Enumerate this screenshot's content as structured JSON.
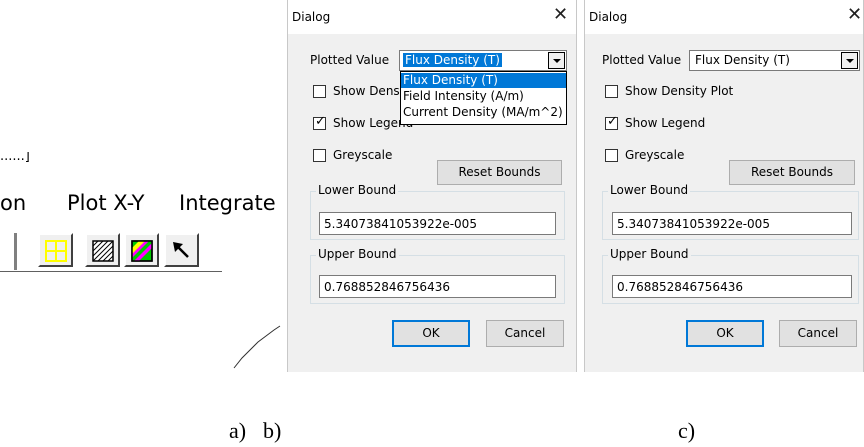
{
  "fragment": {
    "window_title_cut": "......]",
    "menu": [
      {
        "label": "on"
      },
      {
        "label": "Plot X-Y"
      },
      {
        "label": "Integrate"
      }
    ],
    "toolbar_icons": [
      "contour-plot-icon",
      "hatch-plot-icon",
      "density-plot-icon",
      "arrow-select-icon"
    ],
    "toolbar_colors": {
      "contour": "#ffff00",
      "density_green": "#00c800",
      "density_magenta": "#ff00ff",
      "density_yellow": "#ffff00"
    }
  },
  "dialog_b": {
    "title": "Dialog",
    "close_symbol": "✕",
    "plotted_value_label": "Plotted Value",
    "plotted_value": "Flux Density (T)",
    "dropdown_options": [
      "Flux Density (T)",
      "Field Intensity (A/m)",
      "Current Density (MA/m^2)"
    ],
    "dropdown_selected_index": 0,
    "show_density_label_visible": "Show Dens",
    "show_legend_label": "Show Legend",
    "greyscale_label": "Greyscale",
    "show_density_checked": false,
    "show_legend_checked": true,
    "greyscale_checked": false,
    "reset_bounds_label": "Reset Bounds",
    "lower_bound_label": "Lower Bound",
    "lower_bound_value": "5.34073841053922e-005",
    "upper_bound_label": "Upper Bound",
    "upper_bound_value": "0.768852846756436",
    "ok_label": "OK",
    "cancel_label": "Cancel"
  },
  "dialog_c": {
    "title": "Dialog",
    "close_symbol": "✕",
    "plotted_value_label": "Plotted Value",
    "plotted_value": "Flux Density (T)",
    "show_density_label": "Show Density Plot",
    "show_legend_label": "Show Legend",
    "greyscale_label": "Greyscale",
    "show_density_checked": false,
    "show_legend_checked": true,
    "greyscale_checked": false,
    "reset_bounds_label": "Reset Bounds",
    "lower_bound_label": "Lower Bound",
    "lower_bound_value": "5.34073841053922e-005",
    "upper_bound_label": "Upper Bound",
    "upper_bound_value": "0.768852846756436",
    "ok_label": "OK",
    "cancel_label": "Cancel"
  },
  "captions": {
    "a": "a)",
    "b": "b)",
    "c": "c)"
  },
  "accent_color": "#0078d7",
  "check_symbol": "✓"
}
